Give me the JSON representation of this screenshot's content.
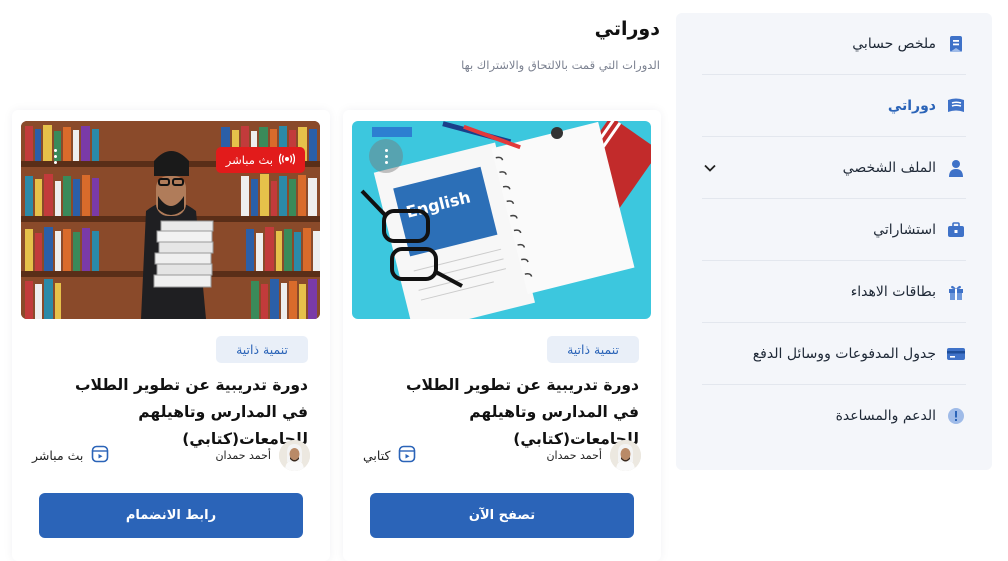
{
  "header": {
    "title": "دوراتي",
    "subtitle": "الدورات التي قمت بالالتحاق والاشتراك بها"
  },
  "sidebar": {
    "items": [
      {
        "label": "ملخص حسابي",
        "icon": "summary-icon"
      },
      {
        "label": "دوراتي",
        "icon": "courses-icon",
        "active": true
      },
      {
        "label": "الملف الشخصي",
        "icon": "user-icon",
        "has_dropdown": true
      },
      {
        "label": "استشاراتي",
        "icon": "briefcase-icon"
      },
      {
        "label": "بطاقات الاهداء",
        "icon": "gift-icon"
      },
      {
        "label": "جدول المدفوعات ووسائل الدفع",
        "icon": "card-icon"
      },
      {
        "label": "الدعم والمساعدة",
        "icon": "info-icon"
      }
    ]
  },
  "courses": [
    {
      "tag": "تنمية ذاتية",
      "title": "دورة تدريبية عن تطوير الطلاب في المدارس وتاهيلهم للجامعات(كتابي)",
      "author": "أحمد حمدان",
      "mode": "كتابي",
      "button": "تصفح الآن",
      "image": "english-notebook"
    },
    {
      "tag": "تنمية ذاتية",
      "title": "دورة تدريبية عن تطوير الطلاب في المدارس وتاهيلهم للجامعات(كتابي)",
      "author": "أحمد حمدان",
      "mode": "بث مباشر",
      "button": "رابط الانضمام",
      "live_badge": "بث مباشر",
      "image": "man-with-books"
    }
  ],
  "colors": {
    "primary": "#2b64b8",
    "live": "#e21b1b",
    "sidebar_bg": "#f4f6fa",
    "tag_bg": "#e9eff8"
  },
  "notebook_label": "English"
}
